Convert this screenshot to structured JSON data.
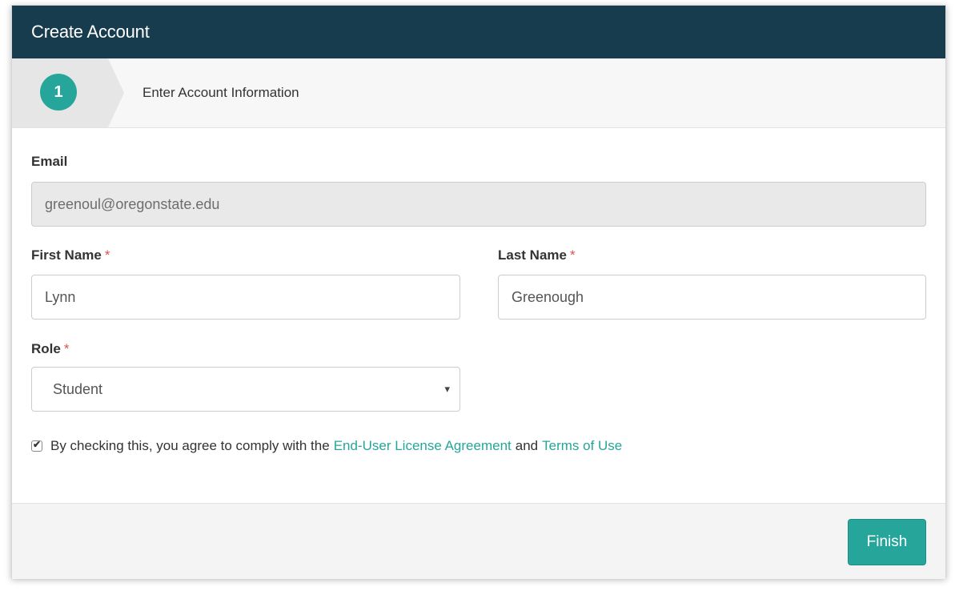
{
  "header": {
    "title": "Create Account"
  },
  "step": {
    "number": "1",
    "label": "Enter Account Information"
  },
  "form": {
    "email": {
      "label": "Email",
      "value": "greenoul@oregonstate.edu"
    },
    "first_name": {
      "label": "First Name",
      "required": "*",
      "value": "Lynn"
    },
    "last_name": {
      "label": "Last Name",
      "required": "*",
      "value": "Greenough"
    },
    "role": {
      "label": "Role",
      "required": "*",
      "value": "Student",
      "caret": "▾"
    }
  },
  "agreement": {
    "checked": true,
    "text_before": "By checking this, you agree to comply with the",
    "eula_link": "End-User License Agreement",
    "text_and": "and",
    "terms_link": "Terms of Use"
  },
  "footer": {
    "finish_label": "Finish"
  },
  "colors": {
    "header_bg": "#173c4e",
    "accent": "#26a69a",
    "required": "#d9534f"
  },
  "icons": {
    "check": "check-icon",
    "caret": "chevron-down-icon"
  }
}
